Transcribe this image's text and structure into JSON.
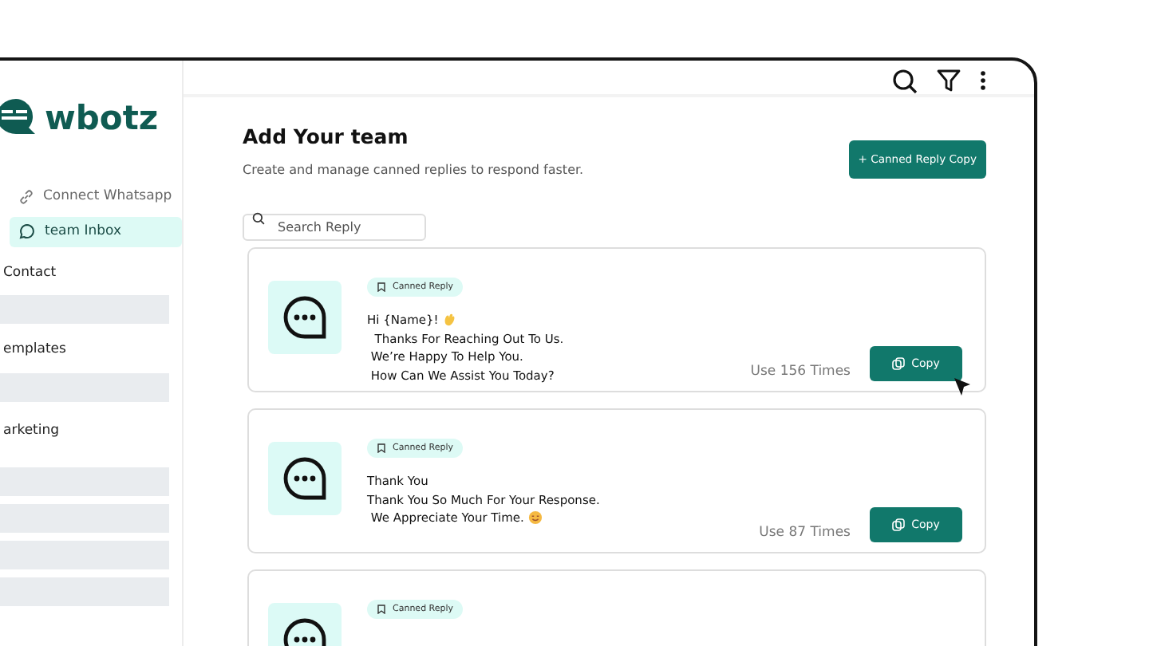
{
  "sidebar": {
    "logo": "wbotz",
    "items": [
      {
        "label": "Connect Whatsapp",
        "kind": "link",
        "selected": false
      },
      {
        "label": "team Inbox",
        "kind": "chat",
        "selected": true
      }
    ],
    "sections": [
      {
        "title": "Contact"
      },
      {
        "title": "emplates"
      },
      {
        "title": "arketing"
      }
    ]
  },
  "page": {
    "title": "Add Your team",
    "subtitle": "Create and manage canned replies to respond faster.",
    "add_button": "+ Canned Reply Copy",
    "search": {
      "placeholder": "Search Reply"
    }
  },
  "cards": [
    {
      "badge": "Canned Reply",
      "lines": [
        "Hi {Name}!",
        "  Thanks For Reaching Out To Us.",
        " We’re Happy To Help You.",
        " How Can We Assist You Today?"
      ],
      "kind": "wave",
      "uses": "Use 156 Times",
      "button": "Copy",
      "hovered": true
    },
    {
      "badge": "Canned Reply",
      "lines": [
        "Thank You",
        "Thank You So Much For Your Response.",
        " We Appreciate Your Time."
      ],
      "kind": "smile",
      "uses": "Use 87 Times",
      "button": "Copy",
      "hovered": false
    },
    {
      "badge": "Canned Reply"
    }
  ]
}
